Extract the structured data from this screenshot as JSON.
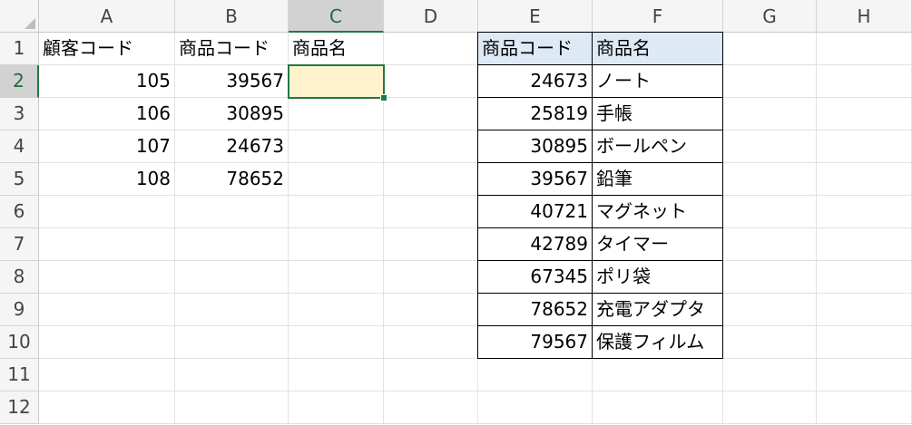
{
  "column_headers": [
    "A",
    "B",
    "C",
    "D",
    "E",
    "F",
    "G",
    "H"
  ],
  "row_headers": [
    "1",
    "2",
    "3",
    "4",
    "5",
    "6",
    "7",
    "8",
    "9",
    "10",
    "11",
    "12"
  ],
  "selected": {
    "column": "C",
    "row": "2"
  },
  "colors": {
    "selection_border": "#1f7a45",
    "active_cell_fill": "#fff2cc",
    "lookup_header_fill": "#dde9f5",
    "lookup_border": "#000000"
  },
  "orders": {
    "headers": [
      "顧客コード",
      "商品コード",
      "商品名"
    ],
    "rows": [
      {
        "customer_code": "105",
        "product_code": "39567",
        "product_name": ""
      },
      {
        "customer_code": "106",
        "product_code": "30895",
        "product_name": ""
      },
      {
        "customer_code": "107",
        "product_code": "24673",
        "product_name": ""
      },
      {
        "customer_code": "108",
        "product_code": "78652",
        "product_name": ""
      }
    ]
  },
  "lookup_table": {
    "headers": [
      "商品コード",
      "商品名"
    ],
    "rows": [
      {
        "code": "24673",
        "name": "ノート"
      },
      {
        "code": "25819",
        "name": "手帳"
      },
      {
        "code": "30895",
        "name": "ボールペン"
      },
      {
        "code": "39567",
        "name": "鉛筆"
      },
      {
        "code": "40721",
        "name": "マグネット"
      },
      {
        "code": "42789",
        "name": "タイマー"
      },
      {
        "code": "67345",
        "name": "ポリ袋"
      },
      {
        "code": "78652",
        "name": "充電アダプタ"
      },
      {
        "code": "79567",
        "name": "保護フィルム"
      }
    ]
  }
}
